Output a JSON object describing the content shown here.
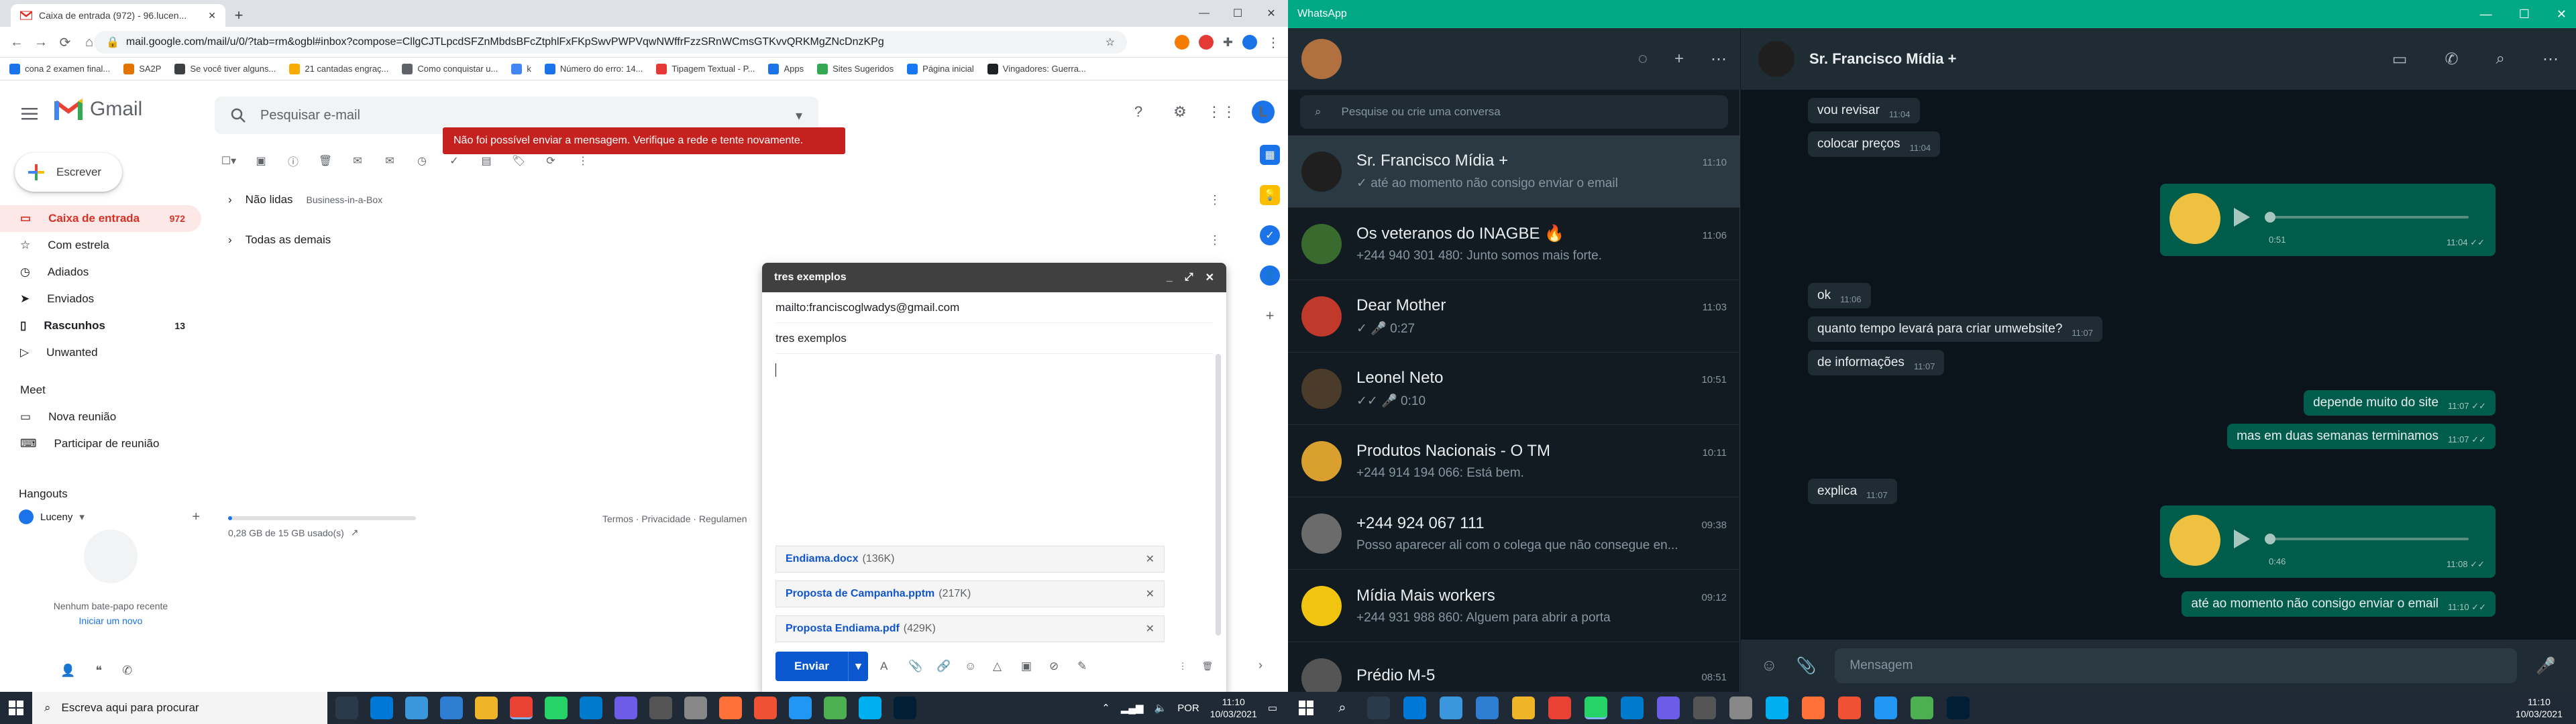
{
  "chrome": {
    "tab_title": "Caixa de entrada (972) - 96.lucen...",
    "url": "mail.google.com/mail/u/0/?tab=rm&ogbl#inbox?compose=CllgCJTLpcdSFZnMbdsBFcZtphlFxFKpSwvPWPVqwNWffrFzzSRnWCmsGTKvvQRKMgZNcDnzKPg",
    "bookmarks": [
      "cona 2 examen final...",
      "SA2P",
      "Se você tiver alguns...",
      "21 cantadas engraç...",
      "Como conquistar u...",
      "k",
      "Número do erro: 14...",
      "Tipagem Textual - P...",
      "Apps",
      "Sites Sugeridos",
      "Página inicial",
      "Vingadores: Guerra..."
    ]
  },
  "gmail": {
    "brand": "Gmail",
    "search_placeholder": "Pesquisar e-mail",
    "error": "Não foi possível enviar a mensagem. Verifique a rede e tente novamente.",
    "compose_label": "Escrever",
    "nav": [
      {
        "label": "Caixa de entrada",
        "count": "972",
        "icon": "inbox-icon",
        "active": true
      },
      {
        "label": "Com estrela",
        "count": "",
        "icon": "star-icon"
      },
      {
        "label": "Adiados",
        "count": "",
        "icon": "clock-icon"
      },
      {
        "label": "Enviados",
        "count": "",
        "icon": "send-icon"
      },
      {
        "label": "Rascunhos",
        "count": "13",
        "icon": "draft-icon",
        "bold": true
      },
      {
        "label": "Unwanted",
        "count": "",
        "icon": "label-icon"
      }
    ],
    "meet": {
      "title": "Meet",
      "items": [
        "Nova reunião",
        "Participar de reunião"
      ]
    },
    "hangouts": {
      "title": "Hangouts",
      "user": "Luceny",
      "empty": "Nenhum bate-papo recente",
      "start": "Iniciar um novo"
    },
    "sections": [
      {
        "title": "Não lidas",
        "sub": "Business-in-a-Box"
      },
      {
        "title": "Todas as demais",
        "sub": ""
      }
    ],
    "storage": "0,28 GB de 15 GB usado(s)",
    "storage_fraction": 0.02,
    "footer_links": "Termos · Privacidade · Regulamen",
    "compose": {
      "title": "tres exemplos",
      "to": "mailto:franciscoglwadys@gmail.com",
      "subject": "tres exemplos",
      "send": "Enviar",
      "attachments": [
        {
          "name": "Endiama.docx",
          "size": "(136K)"
        },
        {
          "name": "Proposta de Campanha.pptm",
          "size": "(217K)"
        },
        {
          "name": "Proposta Endiama.pdf",
          "size": "(429K)"
        }
      ]
    }
  },
  "taskbar_left": {
    "search": "Escreva aqui para procurar",
    "lang": "POR",
    "time": "11:10",
    "date": "10/03/2021"
  },
  "whatsapp": {
    "window_title": "WhatsApp",
    "search_placeholder": "Pesquise ou crie uma conversa",
    "chats": [
      {
        "name": "Sr. Francisco Mídia +",
        "time": "11:10",
        "msg": "✓ até ao momento não consigo enviar o email",
        "avatar": "#1f1f1f",
        "selected": true
      },
      {
        "name": "Os veteranos do INAGBE 🔥",
        "time": "11:06",
        "msg": "+244 940 301 480: Junto somos mais forte.",
        "avatar": "#3a6b2e"
      },
      {
        "name": "Dear Mother",
        "time": "11:03",
        "msg": "✓ 🎤 0:27",
        "avatar": "#c0392b"
      },
      {
        "name": "Leonel Neto",
        "time": "10:51",
        "msg": "✓✓ 🎤 0:10",
        "avatar": "#4a3b2a"
      },
      {
        "name": "Produtos Nacionais - O TM",
        "time": "10:11",
        "msg": "+244 914 194 066: Está bem.",
        "avatar": "#d9a030"
      },
      {
        "name": "+244 924 067 111",
        "time": "09:38",
        "msg": "Posso aparecer ali com o colega que não consegue en...",
        "avatar": "#6b6b6b"
      },
      {
        "name": "Mídia Mais workers",
        "time": "09:12",
        "msg": "+244 931 988 860: Alguem para abrir a porta",
        "avatar": "#f1c40f"
      },
      {
        "name": "Prédio M-5",
        "time": "08:51",
        "msg": "",
        "avatar": "#555"
      }
    ],
    "conversation": {
      "name": "Sr. Francisco Mídia +",
      "messages": [
        {
          "dir": "in",
          "text": "vou revisar",
          "time": "11:04"
        },
        {
          "dir": "in",
          "text": "colocar preços",
          "time": "11:04"
        },
        {
          "dir": "out-voice",
          "duration": "0:51",
          "time": "11:04 ✓✓"
        },
        {
          "dir": "in",
          "text": "ok",
          "time": "11:06"
        },
        {
          "dir": "in",
          "text": "quanto tempo levará para criar umwebsite?",
          "time": "11:07"
        },
        {
          "dir": "in",
          "text": "de informações",
          "time": "11:07"
        },
        {
          "dir": "out",
          "text": "depende muito do site",
          "time": "11:07 ✓✓"
        },
        {
          "dir": "out",
          "text": "mas em duas semanas terminamos",
          "time": "11:07 ✓✓"
        },
        {
          "dir": "in",
          "text": "explica",
          "time": "11:07"
        },
        {
          "dir": "out-voice",
          "duration": "0:46",
          "time": "11:08 ✓✓"
        },
        {
          "dir": "out",
          "text": "até ao momento não consigo enviar o email",
          "time": "11:10 ✓✓"
        }
      ],
      "input_placeholder": "Mensagem"
    }
  },
  "taskbar_right": {
    "time": "11:10",
    "date": "10/03/2021"
  }
}
